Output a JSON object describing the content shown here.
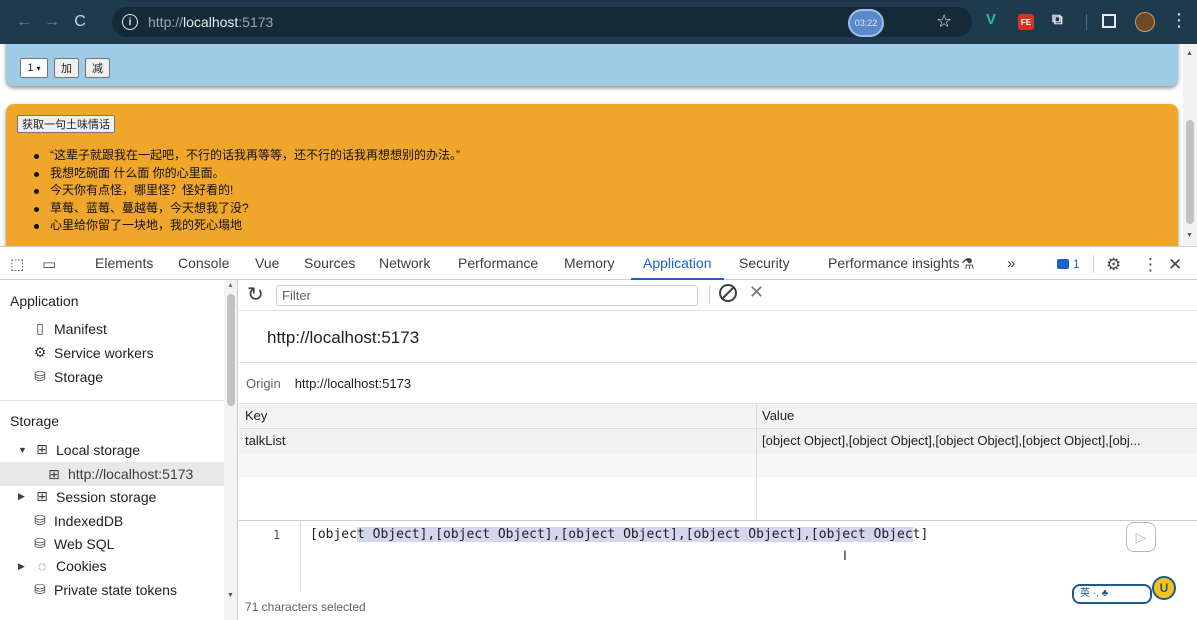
{
  "browser": {
    "url_prefix": "http://",
    "url_host": "localhost",
    "url_port": ":5173",
    "timer": "03:22",
    "ext_fe_label": "FE",
    "ext_v_label": "V"
  },
  "page": {
    "counter_select": "1",
    "add_button": "加",
    "subtract_button": "减",
    "fetch_button": "获取一句土味情话",
    "talk_list": [
      "“这辈子就跟我在一起吧，不行的话我再等等，还不行的话我再想想别的办法。”",
      "我想吃碗面 什么面 你的心里面。",
      "今天你有点怪，哪里怪？怪好看的!",
      "草莓、蓝莓、蔓越莓，今天想我了没?",
      "心里给你留了一块地，我的死心塌地"
    ]
  },
  "devtools": {
    "tabs": [
      "Elements",
      "Console",
      "Vue",
      "Sources",
      "Network",
      "Performance",
      "Memory",
      "Application",
      "Security",
      "Performance insights"
    ],
    "active_tab": "Application",
    "more_tabs": "»",
    "message_count": "1",
    "sidebar": {
      "application_title": "Application",
      "manifest": "Manifest",
      "service_workers": "Service workers",
      "storage_item": "Storage",
      "storage_title": "Storage",
      "local_storage": "Local storage",
      "local_storage_origin": "http://localhost:5173",
      "session_storage": "Session storage",
      "indexeddb": "IndexedDB",
      "web_sql": "Web SQL",
      "cookies": "Cookies",
      "private_state_tokens": "Private state tokens"
    },
    "main": {
      "filter_placeholder": "Filter",
      "origin_header": "http://localhost:5173",
      "origin_label": "Origin",
      "origin_value": "http://localhost:5173",
      "columns": {
        "key": "Key",
        "value": "Value"
      },
      "rows": [
        {
          "key": "talkList",
          "value": "[object Object],[object Object],[object Object],[object Object],[obj..."
        }
      ],
      "preview_line_number": "1",
      "preview_text_pre": "[objec",
      "preview_text_hl": "t Object],[object Object],[object Object],[object Object],[object Objec",
      "preview_text_post": "t]",
      "status_text": "71 characters selected"
    }
  },
  "overlay": {
    "ime_label": "英 ·, ♣"
  },
  "colors": {
    "accent_blue": "#1a62d0",
    "orange_card": "#efa62a",
    "blue_card": "#9ecbe6",
    "browser_bar": "#1f3a4d"
  }
}
